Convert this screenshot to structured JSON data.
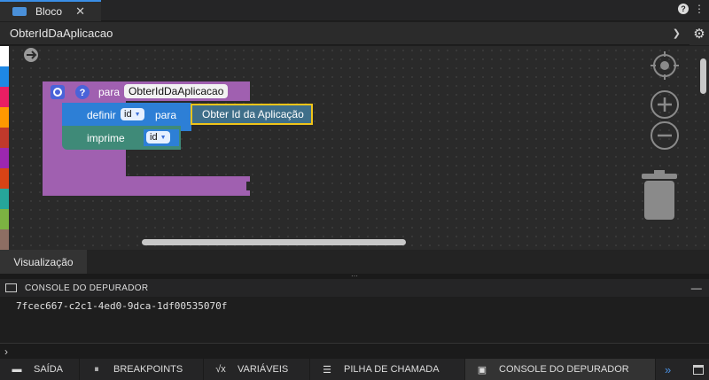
{
  "tab": {
    "title": "Bloco",
    "close": "✕"
  },
  "header_right": {
    "help": "?",
    "more": "⋮"
  },
  "function_selector": {
    "value": "ObterIdDaAplicacao"
  },
  "blocks": {
    "function": {
      "keyword": "para",
      "name": "ObterIdDaAplicacao"
    },
    "set": {
      "keyword": "definir",
      "var": "id",
      "to": "para",
      "value": "Obter Id da Aplicação"
    },
    "print": {
      "keyword": "imprime",
      "var": "id"
    }
  },
  "palette_colors": [
    "#ffffff",
    "#1e88e5",
    "#e91e63",
    "#ff9800",
    "#c0392b",
    "#9c27b0",
    "#d84315",
    "#26a69a",
    "#7cb342",
    "#8d6e63"
  ],
  "visualization_tab": {
    "label": "Visualização"
  },
  "console": {
    "title": "CONSOLE DO DEPURADOR",
    "output": "7fcec667-c2c1-4ed0-9dca-1df00535070f",
    "prompt": "›"
  },
  "bottom_tabs": [
    {
      "label": "SAÍDA"
    },
    {
      "label": "BREAKPOINTS"
    },
    {
      "label": "VARIÁVEIS"
    },
    {
      "label": "PILHA DE CHAMADA"
    },
    {
      "label": "CONSOLE DO DEPURADOR"
    }
  ],
  "bottom_more": "»",
  "colors": {
    "function_block": "#a060b0",
    "set_block": "#2d7fd6",
    "print_block": "#3f8a78",
    "selected_outline": "#f0c419"
  }
}
